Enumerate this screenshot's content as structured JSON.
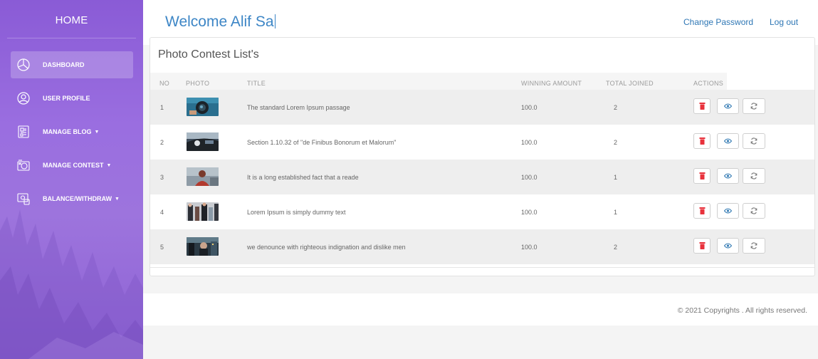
{
  "sidebar": {
    "brand": "HOME",
    "items": [
      {
        "label": "DASHBOARD",
        "icon": "pie-chart-icon",
        "active": true,
        "caret": ""
      },
      {
        "label": "USER PROFILE",
        "icon": "user-circle-icon",
        "active": false,
        "caret": ""
      },
      {
        "label": "MANAGE BLOG",
        "icon": "blog-icon",
        "active": false,
        "caret": "▼"
      },
      {
        "label": "MANAGE CONTEST",
        "icon": "camera-icon",
        "active": false,
        "caret": "▼"
      },
      {
        "label": "BALANCE/WITHDRAW",
        "icon": "wallet-icon",
        "active": false,
        "caret": "▼"
      }
    ]
  },
  "header": {
    "welcome": "Welcome Alif Sa",
    "change_password": "Change Password",
    "logout": "Log out"
  },
  "contest_list": {
    "title": "Photo Contest List's",
    "columns": {
      "no": "NO",
      "photo": "PHOTO",
      "title": "TITLE",
      "winning_amount": "WINNING AMOUNT",
      "total_joined": "TOTAL JOINED",
      "actions": "ACTIONS"
    },
    "rows": [
      {
        "no": "1",
        "photo": "camera-lens-photo",
        "title": "The standard Lorem Ipsum passage",
        "winning_amount": "100.0",
        "total_joined": "2"
      },
      {
        "no": "2",
        "photo": "car-interior-photo",
        "title": "Section 1.10.32 of \"de Finibus Bonorum et Malorum\"",
        "winning_amount": "100.0",
        "total_joined": "2"
      },
      {
        "no": "3",
        "photo": "portrait-photo",
        "title": "It is a long established fact that a reade",
        "winning_amount": "100.0",
        "total_joined": "1"
      },
      {
        "no": "4",
        "photo": "street-people-photo",
        "title": "Lorem Ipsum is simply dummy text",
        "winning_amount": "100.0",
        "total_joined": "1"
      },
      {
        "no": "5",
        "photo": "city-night-photo",
        "title": "we denounce with righteous indignation and dislike men",
        "winning_amount": "100.0",
        "total_joined": "2"
      }
    ],
    "action_icons": [
      "trash-icon",
      "eye-icon",
      "refresh-icon"
    ]
  },
  "footer": {
    "copyright": "© 2021 Copyrights . All rights reserved."
  },
  "colors": {
    "sidebar_purple": "#9a6ee0",
    "link_blue": "#2f77b5",
    "delete_red": "#e8323c"
  }
}
